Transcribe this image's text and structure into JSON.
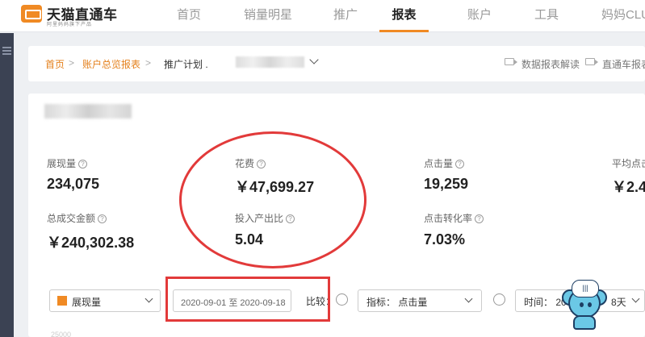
{
  "brand": {
    "title": "天猫直通车",
    "subtitle": "阿里妈妈旗下产品"
  },
  "nav": [
    {
      "label": "首页",
      "active": false
    },
    {
      "label": "销量明星",
      "active": false
    },
    {
      "label": "推广",
      "active": false
    },
    {
      "label": "报表",
      "active": true
    },
    {
      "label": "账户",
      "active": false
    },
    {
      "label": "工具",
      "active": false
    },
    {
      "label": "妈妈CLUB",
      "active": false
    }
  ],
  "breadcrumb": {
    "home": "首页",
    "sep": ">",
    "overview": "账户总览报表",
    "plan": "推广计划 .",
    "links": [
      "数据报表解读",
      "直通车报表"
    ]
  },
  "metrics": [
    {
      "label": "展现量",
      "value": "234,075"
    },
    {
      "label": "花费",
      "value": "￥47,699.27"
    },
    {
      "label": "点击量",
      "value": "19,259"
    },
    {
      "label": "平均点击",
      "value": "￥2.4"
    },
    {
      "label": "总成交金额",
      "value": "￥240,302.38"
    },
    {
      "label": "投入产出比",
      "value": "5.04"
    },
    {
      "label": "点击转化率",
      "value": "7.03%"
    }
  ],
  "controls": {
    "metric_select": "展现量",
    "date_range": "2020-09-01 至 2020-09-18",
    "compare_label": "比较：",
    "indicator_select": "指标：  点击量",
    "time_select": "时间：  20",
    "time_suffix": "8天"
  },
  "chart_axis_top": "25000",
  "mascot_icon": "headset-mouse-icon",
  "colors": {
    "accent": "#f08a24",
    "annotation": "#e23a3a",
    "sidebar": "#3b4253"
  }
}
